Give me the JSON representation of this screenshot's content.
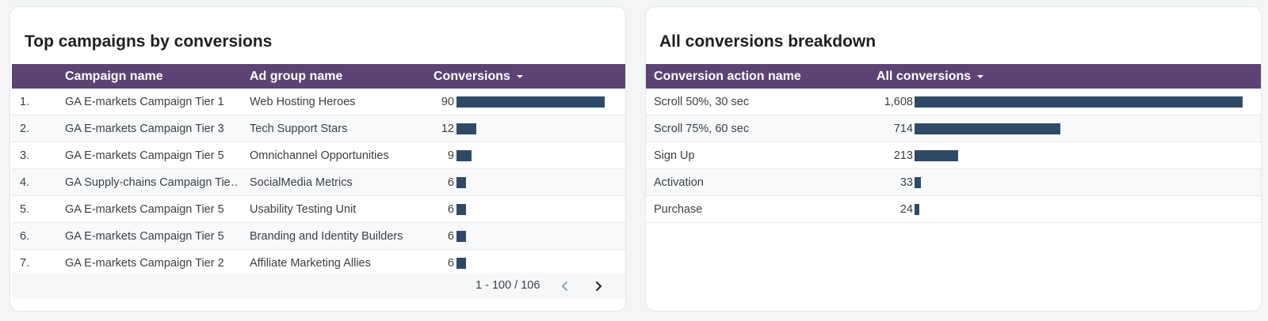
{
  "left": {
    "title": "Top campaigns by conversions",
    "headers": {
      "campaign": "Campaign name",
      "ad_group": "Ad group name",
      "conversions": "Conversions"
    },
    "rows": [
      {
        "idx": "1.",
        "campaign": "GA E-markets Campaign Tier 1",
        "ad_group": "Web Hosting Heroes",
        "conversions": "90",
        "value": 90
      },
      {
        "idx": "2.",
        "campaign": "GA E-markets Campaign Tier 3",
        "ad_group": "Tech Support Stars",
        "conversions": "12",
        "value": 12
      },
      {
        "idx": "3.",
        "campaign": "GA E-markets Campaign Tier 5",
        "ad_group": "Omnichannel Opportunities",
        "conversions": "9",
        "value": 9
      },
      {
        "idx": "4.",
        "campaign": "GA Supply-chains Campaign Tie…",
        "ad_group": "SocialMedia Metrics",
        "conversions": "6",
        "value": 6
      },
      {
        "idx": "5.",
        "campaign": "GA E-markets Campaign Tier 5",
        "ad_group": "Usability Testing Unit",
        "conversions": "6",
        "value": 6
      },
      {
        "idx": "6.",
        "campaign": "GA E-markets Campaign Tier 5",
        "ad_group": "Branding and Identity Builders",
        "conversions": "6",
        "value": 6
      },
      {
        "idx": "7.",
        "campaign": "GA E-markets Campaign Tier 2",
        "ad_group": "Affiliate Marketing Allies",
        "conversions": "6",
        "value": 6
      }
    ],
    "pagination": "1 - 100 / 106"
  },
  "right": {
    "title": "All conversions breakdown",
    "headers": {
      "action": "Conversion action name",
      "all": "All conversions"
    },
    "rows": [
      {
        "action": "Scroll 50%, 30 sec",
        "all": "1,608",
        "value": 1608
      },
      {
        "action": "Scroll 75%, 60 sec",
        "all": "714",
        "value": 714
      },
      {
        "action": "Sign Up",
        "all": "213",
        "value": 213
      },
      {
        "action": "Activation",
        "all": "33",
        "value": 33
      },
      {
        "action": "Purchase",
        "all": "24",
        "value": 24
      }
    ]
  },
  "colors": {
    "header_bg": "#5c4373",
    "bar": "#2f4a66"
  },
  "icons": {
    "sort": "sort-desc-icon",
    "prev": "chevron-left-icon",
    "next": "chevron-right-icon"
  }
}
